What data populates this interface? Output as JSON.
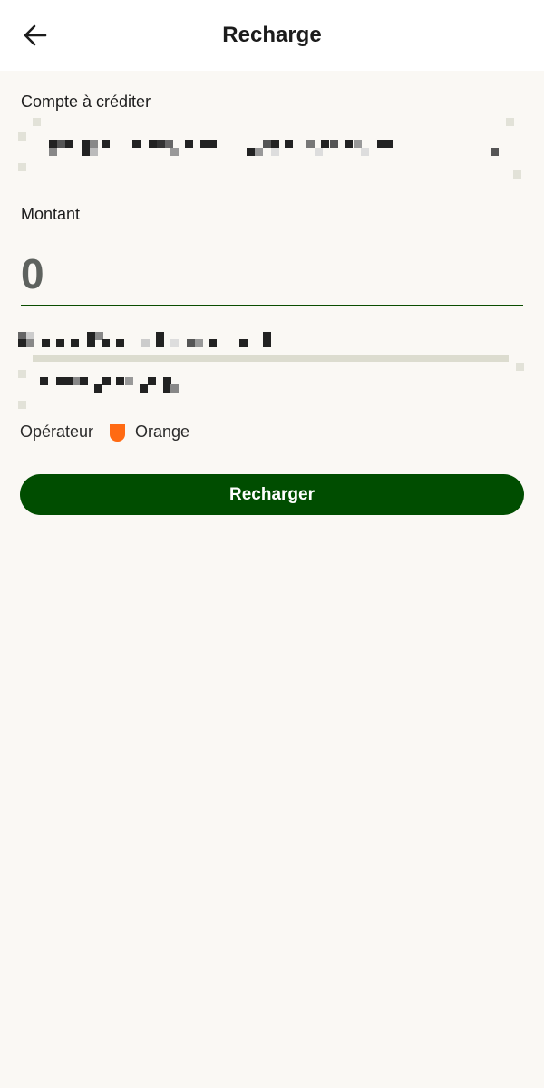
{
  "header": {
    "title": "Recharge",
    "back_icon": "arrow-left-icon"
  },
  "form": {
    "account_label": "Compte à créditer",
    "amount_label": "Montant",
    "amount_value": "0",
    "operator_label": "Opérateur",
    "operator_name": "Orange",
    "operator_icon": "orange-operator-icon",
    "submit_label": "Recharger"
  },
  "colors": {
    "primary": "#004d00",
    "underline": "#0a4d00",
    "background": "#faf8f4",
    "operator_orange": "#ff6a13"
  }
}
